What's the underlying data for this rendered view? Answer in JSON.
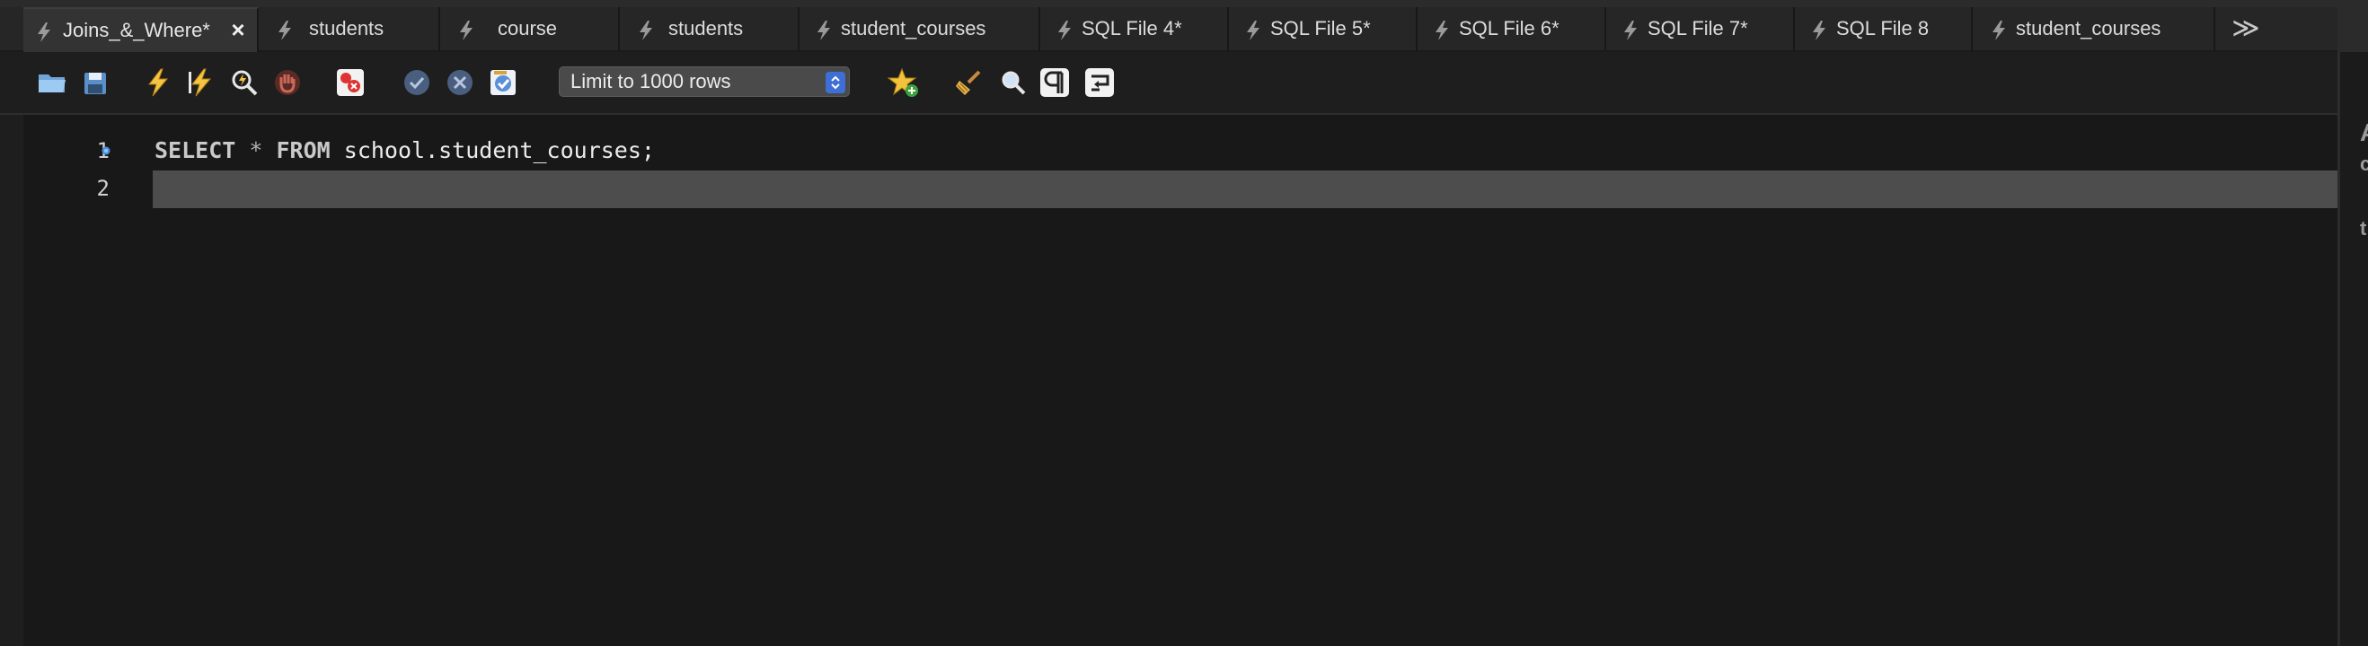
{
  "tabs": [
    {
      "label": "Joins_&_Where*",
      "active": true,
      "closable": true
    },
    {
      "label": "students"
    },
    {
      "label": "course"
    },
    {
      "label": "students"
    },
    {
      "label": "student_courses"
    },
    {
      "label": "SQL File 4*"
    },
    {
      "label": "SQL File 5*"
    },
    {
      "label": "SQL File 6*"
    },
    {
      "label": "SQL File 7*"
    },
    {
      "label": "SQL File 8"
    },
    {
      "label": "student_courses"
    }
  ],
  "tab_overflow": "≫",
  "toolbar": {
    "icons": [
      "open-file-icon",
      "save-icon",
      "execute-icon",
      "execute-current-icon",
      "explain-icon",
      "stop-icon",
      "toggle-error-icon",
      "commit-icon",
      "rollback-icon",
      "autocommit-icon",
      "add-snippet-icon",
      "beautify-icon",
      "find-icon",
      "invisible-chars-icon",
      "wrap-lines-icon"
    ],
    "limit_select": {
      "value": "Limit to 1000 rows",
      "options": [
        "Limit to 1000 rows"
      ]
    }
  },
  "editor": {
    "lines": [
      {
        "number": "1",
        "tokens": [
          {
            "t": "SELECT",
            "c": "kw"
          },
          {
            "t": " ",
            "c": ""
          },
          {
            "t": "*",
            "c": "op"
          },
          {
            "t": " ",
            "c": ""
          },
          {
            "t": "FROM",
            "c": "kw"
          },
          {
            "t": " school.student_courses;",
            "c": ""
          }
        ],
        "marker": true
      },
      {
        "number": "2",
        "tokens": [],
        "current": true
      }
    ]
  },
  "side_panel": {
    "stubs": [
      "A",
      "c",
      "t"
    ]
  },
  "colors": {
    "accent": "#3d6fd6",
    "marker": "#4a90e2",
    "background": "#181818",
    "current_line": "#4d4d4d"
  }
}
